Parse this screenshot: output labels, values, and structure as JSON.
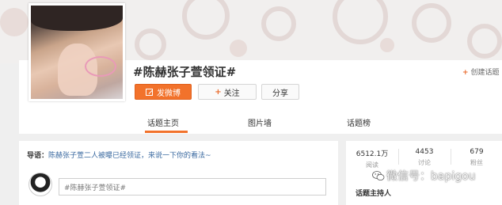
{
  "topic": {
    "title": "#陈赫张子萱领证#",
    "create_topic_label": "创建话题"
  },
  "actions": {
    "post_label": "发微博",
    "follow_label": "关注",
    "share_label": "分享"
  },
  "tabs": [
    {
      "label": "话题主页"
    },
    {
      "label": "图片墙"
    },
    {
      "label": "话题榜"
    }
  ],
  "post": {
    "intro_lead": "导语：",
    "intro_text": "陈赫张子萱二人被曝已经领证，来说一下你的看法~",
    "input_value": "#陈赫张子萱领证#"
  },
  "stats": {
    "reads_value": "6512.1万",
    "reads_label": "阅读",
    "discuss_value": "4453",
    "discuss_label": "讨论",
    "fans_value": "679",
    "fans_label": "粉丝"
  },
  "host": {
    "title": "话题主持人"
  },
  "watermark": {
    "text": "微信号：bapigou"
  },
  "colors": {
    "accent": "#f2722b",
    "link": "#3b6aa0"
  }
}
